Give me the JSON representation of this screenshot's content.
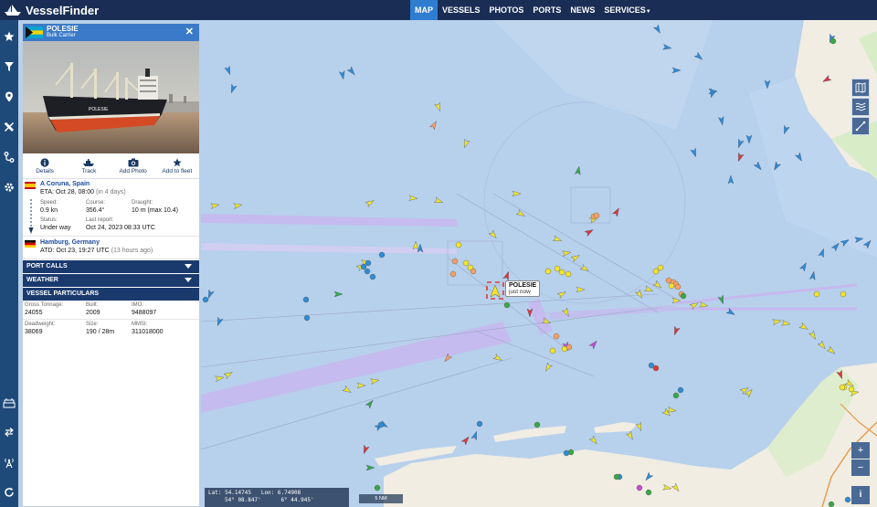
{
  "brand": {
    "name": "VesselFinder"
  },
  "nav": [
    {
      "label": "MAP"
    },
    {
      "label": "VESSELS"
    },
    {
      "label": "PHOTOS"
    },
    {
      "label": "PORTS"
    },
    {
      "label": "NEWS"
    },
    {
      "label": "SERVICES"
    }
  ],
  "left_rail": [
    "star-icon",
    "filter-icon",
    "pin-icon",
    "tools-icon",
    "route-icon",
    "gear-icon",
    "port-icon",
    "swap-icon",
    "antenna-icon",
    "refresh-icon"
  ],
  "vessel": {
    "name": "POLESIE",
    "type": "Bulk Carrier",
    "hull_text": "POLESIE",
    "actions": [
      "Details",
      "Track",
      "Add Photo",
      "Add to fleet"
    ],
    "destination": "A Coruna, Spain",
    "eta_label": "ETA: Oct 28, 08:00",
    "eta_rel": "(in 4 days)",
    "speed_label": "Speed:",
    "speed": "0.9 kn",
    "course_label": "Course:",
    "course": "356.4°",
    "draught_label": "Draught:",
    "draught": "10 m (max 10.4)",
    "status_label": "Status:",
    "status": "Under way",
    "report_label": "Last report:",
    "report": "Oct 24, 2023 08:33 UTC",
    "origin": "Hamburg, Germany",
    "atd_label": "ATD: Oct 23, 19:27 UTC",
    "atd_rel": "(13 hours ago)",
    "sections": [
      "PORT CALLS",
      "WEATHER",
      "VESSEL PARTICULARS"
    ],
    "particulars": {
      "gt_label": "Gross Tonnage:",
      "gt": "24055",
      "built_label": "Built:",
      "built": "2009",
      "imo_label": "IMO:",
      "imo": "9488097",
      "dwt_label": "Deadweight:",
      "dwt": "38069",
      "size_label": "Size:",
      "size": "190 / 28m",
      "mmsi_label": "MMSI:",
      "mmsi": "311018000"
    }
  },
  "tooltip": {
    "name": "POLESIE",
    "time": "just now"
  },
  "coords": {
    "lat_label": "Lat:",
    "lat": "54.14745",
    "lat_dms": "54° 08.847'",
    "lon_label": "Lon:",
    "lon": "6.74908",
    "lon_dms": "6° 44.945'"
  },
  "scale": "5 NM",
  "zoom": {
    "in": "+",
    "out": "−"
  },
  "info_label": "i",
  "colors": {
    "topbar": "#1a2e55",
    "accent": "#2f7dd1",
    "panel_head": "#3a7ac8",
    "sea": "#b7d0ec",
    "land": "#f1ede3",
    "lane": "#c6b8ee",
    "cargo": "#f2e42e",
    "tanker": "#d93a3a",
    "passenger": "#2f8bd6",
    "fishing": "#f5a06a"
  }
}
